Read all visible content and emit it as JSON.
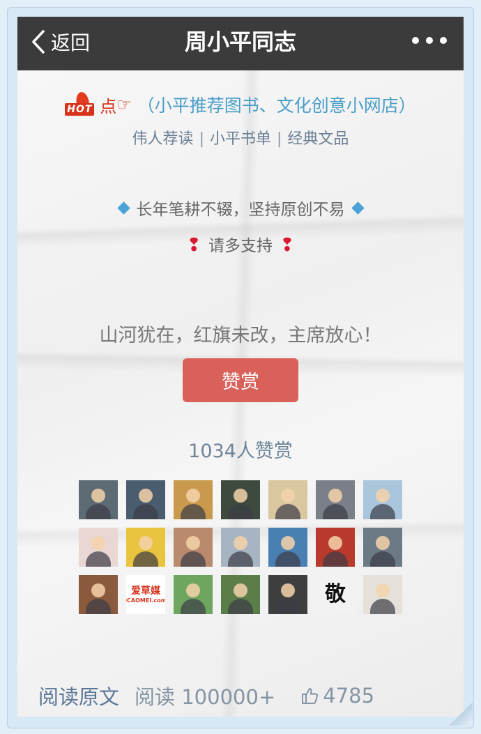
{
  "topbar": {
    "back_label": "返回",
    "title": "周小平同志"
  },
  "promo": {
    "hot_text": "HOT",
    "dian": "点",
    "hand": "☞",
    "link_text": "（小平推荐图书、文化创意小网店）"
  },
  "links": {
    "items": [
      "伟人荐读",
      "小平书单",
      "经典文品"
    ],
    "separator": "|"
  },
  "motto": {
    "line1": "长年笔耕不辍，坚持原创不易",
    "line2": "请多支持",
    "excl_mark": "❢"
  },
  "reward": {
    "slogan": "山河犹在，红旗未改，主席放心！",
    "button_label": "赞赏",
    "count_text": "1034人赞赏"
  },
  "avatars": [
    {
      "color": "#5d6b74"
    },
    {
      "color": "#4a5d6e"
    },
    {
      "color": "#c99a4d"
    },
    {
      "color": "#3f4a3e"
    },
    {
      "color": "#d9c7a0"
    },
    {
      "color": "#7b8088"
    },
    {
      "color": "#a9c6dc"
    },
    {
      "color": "#e9d7d4"
    },
    {
      "color": "#e9c43f"
    },
    {
      "color": "#b98a6e"
    },
    {
      "color": "#a7b4c2"
    },
    {
      "color": "#4a7fb3"
    },
    {
      "color": "#b83a2c"
    },
    {
      "color": "#6c7a86"
    },
    {
      "color": "#8a5a3c"
    },
    {
      "color": "#ffffff",
      "label_top": "爱草媒",
      "label_bottom": "ICAOMEI.com"
    },
    {
      "color": "#6ea55f"
    },
    {
      "color": "#5a7d4a"
    },
    {
      "color": "#3e3e3e"
    },
    {
      "color": "#f2f2f2",
      "label_top": "敬",
      "dark": true
    },
    {
      "color": "#e5e0da"
    }
  ],
  "footer": {
    "read_original": "阅读原文",
    "reads_label": "阅读 100000+",
    "likes": "4785"
  },
  "colors": {
    "topbar": "#3b3b3b",
    "accent_link": "#4a9ec9",
    "reward_button": "#d9615a",
    "hot_red": "#d8321b"
  }
}
